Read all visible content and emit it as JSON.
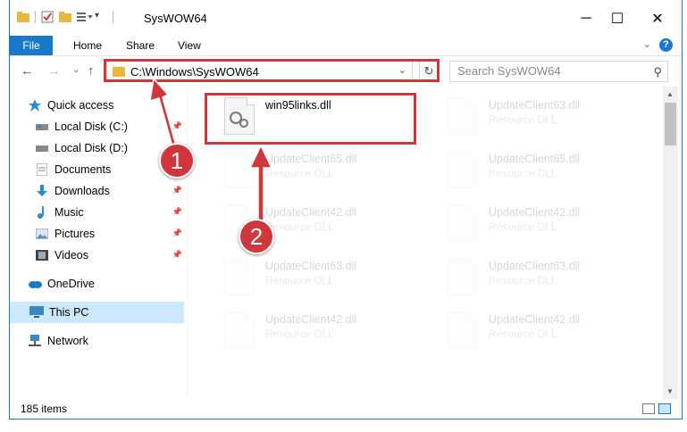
{
  "window": {
    "title": "SysWOW64",
    "minimize": "─",
    "maximize": "☐",
    "close": "✕"
  },
  "ribbon": {
    "tabs": [
      "File",
      "Home",
      "Share",
      "View"
    ],
    "help": "?",
    "expand": "⌄"
  },
  "nav": {
    "back": "←",
    "forward": "→",
    "recent": "⌄",
    "up": "↑",
    "address": "C:\\Windows\\SysWOW64",
    "address_chevron": "⌄",
    "refresh": "↻",
    "search_placeholder": "Search SysWOW64",
    "search_icon": "⚲"
  },
  "sidebar": {
    "items": [
      {
        "label": "Quick access",
        "icon": "star-icon",
        "color": "#2a8ad4"
      },
      {
        "label": "Local Disk (C:)",
        "icon": "drive-icon",
        "color": "#555555"
      },
      {
        "label": "Local Disk (D:)",
        "icon": "drive-icon",
        "color": "#555555"
      },
      {
        "label": "Documents",
        "icon": "documents-icon",
        "color": "#7a7a7a"
      },
      {
        "label": "Downloads",
        "icon": "download-icon",
        "color": "#2a8ad4"
      },
      {
        "label": "Music",
        "icon": "music-icon",
        "color": "#2a8ad4"
      },
      {
        "label": "Pictures",
        "icon": "pictures-icon",
        "color": "#6a8fb5"
      },
      {
        "label": "Videos",
        "icon": "videos-icon",
        "color": "#555555"
      },
      {
        "label": "OneDrive",
        "icon": "cloud-icon",
        "color": "#1979ca"
      },
      {
        "label": "This PC",
        "icon": "computer-icon",
        "color": "#3a87c8"
      },
      {
        "label": "Network",
        "icon": "network-icon",
        "color": "#3a87c8"
      }
    ],
    "pin_symbol": "📌"
  },
  "files": [
    {
      "name": "win95links.dll",
      "type": ""
    },
    {
      "name": "UpdateClient63.dll",
      "type": "Resource DLL"
    },
    {
      "name": "UpdateClient65.dll",
      "type": "Resource DLL"
    },
    {
      "name": "UpdateClient65.dll",
      "type": "Resource DLL"
    },
    {
      "name": "UpdateClient42.dll",
      "type": "Resource DLL"
    },
    {
      "name": "UpdateClient42.dll",
      "type": "Resource DLL"
    },
    {
      "name": "UpdateClient63.dll",
      "type": "Resource DLL"
    },
    {
      "name": "UpdateClient63.dll",
      "type": "Resource DLL"
    },
    {
      "name": "UpdateClient42.dll",
      "type": "Resource DLL"
    },
    {
      "name": "UpdateClient42.dll",
      "type": "Resource DLL"
    }
  ],
  "status": {
    "count": "185 items"
  },
  "annotations": {
    "step1": "1",
    "step2": "2",
    "color": "#d0373d"
  }
}
